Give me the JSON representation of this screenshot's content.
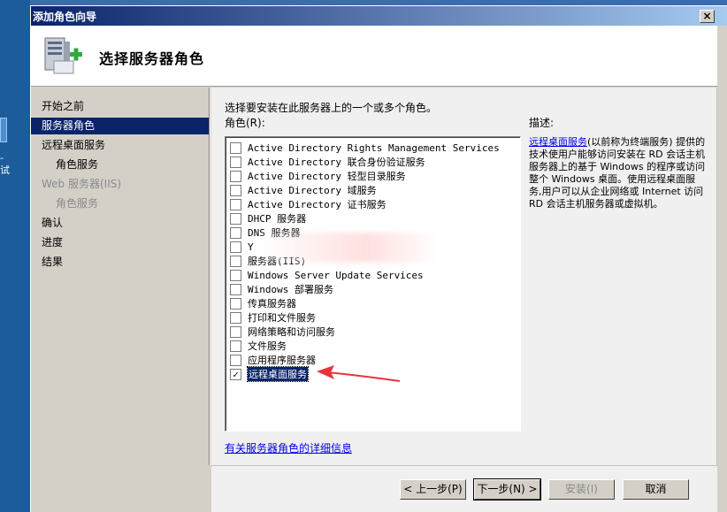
{
  "desktop": {
    "text": "- 试"
  },
  "window": {
    "title": "添加角色向导",
    "close_label": "×"
  },
  "header": {
    "title": "选择服务器角色"
  },
  "nav": {
    "items": [
      {
        "label": "开始之前",
        "state": "normal",
        "level": 0
      },
      {
        "label": "服务器角色",
        "state": "active",
        "level": 0
      },
      {
        "label": "远程桌面服务",
        "state": "normal",
        "level": 0
      },
      {
        "label": "角色服务",
        "state": "normal",
        "level": 1
      },
      {
        "label": "Web 服务器(IIS)",
        "state": "disabled",
        "level": 0
      },
      {
        "label": "角色服务",
        "state": "disabled",
        "level": 1
      },
      {
        "label": "确认",
        "state": "normal",
        "level": 0
      },
      {
        "label": "进度",
        "state": "normal",
        "level": 0
      },
      {
        "label": "结果",
        "state": "normal",
        "level": 0
      }
    ]
  },
  "main": {
    "instruction": "选择要安装在此服务器上的一个或多个角色。",
    "roles_label": "角色(R):",
    "desc_label": "描述:",
    "roles": [
      {
        "label": "Active Directory Rights Management Services",
        "checked": false
      },
      {
        "label": "Active Directory 联合身份验证服务",
        "checked": false
      },
      {
        "label": "Active Directory 轻型目录服务",
        "checked": false
      },
      {
        "label": "Active Directory 域服务",
        "checked": false
      },
      {
        "label": "Active Directory 证书服务",
        "checked": false
      },
      {
        "label": "DHCP 服务器",
        "checked": false
      },
      {
        "label": "DNS 服务器",
        "checked": false
      },
      {
        "label": "Y",
        "checked": false
      },
      {
        "label": "服务器(IIS)",
        "checked": false
      },
      {
        "label": "Windows Server Update Services",
        "checked": false
      },
      {
        "label": "Windows 部署服务",
        "checked": false
      },
      {
        "label": "传真服务器",
        "checked": false
      },
      {
        "label": "打印和文件服务",
        "checked": false
      },
      {
        "label": "网络策略和访问服务",
        "checked": false
      },
      {
        "label": "文件服务",
        "checked": false
      },
      {
        "label": "应用程序服务器",
        "checked": false
      },
      {
        "label": "远程桌面服务",
        "checked": true,
        "selected": true
      }
    ],
    "description": {
      "link": "远程桌面服务",
      "text": "(以前称为终端服务) 提供的技术使用户能够访问安装在 RD 会话主机服务器上的基于 Windows 的程序或访问整个 Windows 桌面。使用远程桌面服务,用户可以从企业网络或 Internet 访问 RD 会话主机服务器或虚拟机。"
    },
    "more_info": "有关服务器角色的详细信息"
  },
  "footer": {
    "prev": "< 上一步(P)",
    "next": "下一步(N) >",
    "install": "安装(I)",
    "cancel": "取消"
  },
  "colors": {
    "accent": "#0a246a",
    "annotation_arrow": "#e8333a"
  }
}
